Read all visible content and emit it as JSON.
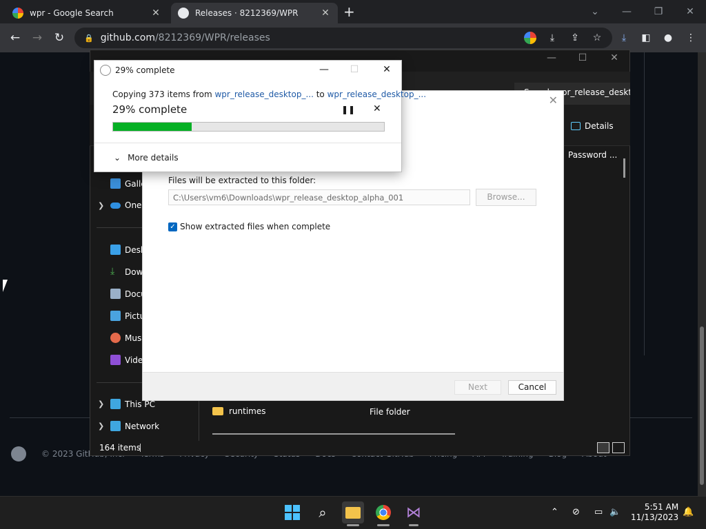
{
  "browser": {
    "tabs": [
      {
        "title": "wpr - Google Search",
        "close": "✕"
      },
      {
        "title": "Releases · 8212369/WPR",
        "close": "✕"
      }
    ],
    "new_tab": "+",
    "url_host": "github.com",
    "url_path": "/8212369/WPR/releases"
  },
  "github_footer": {
    "copyright": "© 2023 GitHub, Inc.",
    "links": [
      "Terms",
      "Privacy",
      "Security",
      "Status",
      "Docs",
      "Contact GitHub",
      "Pricing",
      "API",
      "Training",
      "Blog",
      "About"
    ]
  },
  "explorer": {
    "tab2_label": "Search wpr_release_desktop",
    "details_label": "Details",
    "column_password": "Password ...",
    "nav": {
      "gallery": "Gallery",
      "onedrive": "OneDrive",
      "desktop": "Desktop",
      "downloads": "Downloads",
      "documents": "Documents",
      "pictures": "Pictures",
      "music": "Music",
      "videos": "Videos",
      "this_pc": "This PC",
      "network": "Network"
    },
    "row": {
      "name": "runtimes",
      "type": "File folder"
    },
    "status_count": "164 items"
  },
  "wizard": {
    "extract_label": "Files will be extracted to this folder:",
    "path_value": "C:\\Users\\vm6\\Downloads\\wpr_release_desktop_alpha_001",
    "browse_label": "Browse...",
    "show_files_label": "Show extracted files when complete",
    "show_files_checked": true,
    "next_label": "Next",
    "cancel_label": "Cancel"
  },
  "copy_dialog": {
    "title": "29% complete",
    "copying_prefix": "Copying 373 items from ",
    "source": "wpr_release_desktop_...",
    "to_word": " to ",
    "destination": "wpr_release_desktop_...",
    "percent_text": "29% complete",
    "progress": 0.29,
    "more_details": "More details",
    "progress_color": "#06b025"
  },
  "taskbar": {
    "time": "5:51 AM",
    "date": "11/13/2023"
  }
}
